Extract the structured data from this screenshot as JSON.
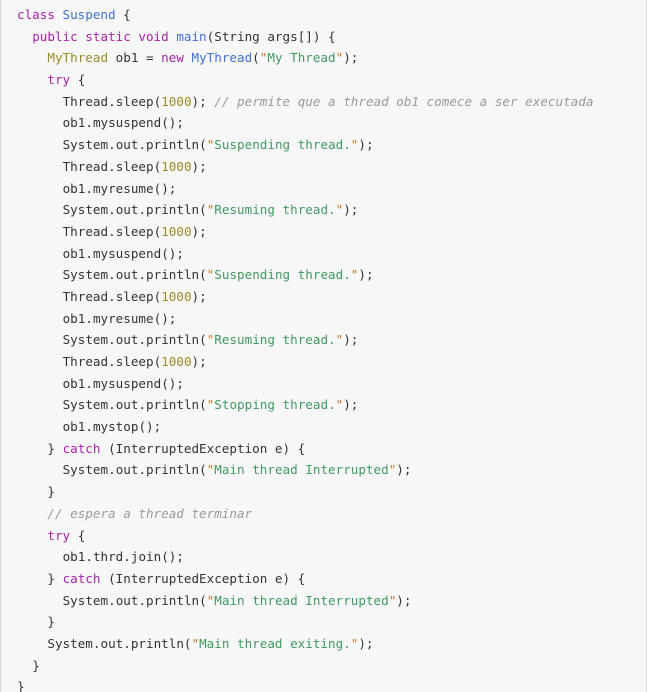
{
  "editor": {
    "language": "java",
    "background_color": "#f7f7f7",
    "border_color": "#d6d6d6",
    "theme": {
      "keyword_color": "#aa22aa",
      "type_color": "#4070d0",
      "declared_type_color": "#9e8a26",
      "number_color": "#9e8a26",
      "string_color": "#3f9a60",
      "quote_color": "#c07828",
      "comment_color": "#999999",
      "plain_color": "#333333"
    }
  },
  "code": {
    "lines": [
      {
        "indent": 0,
        "text": "class Suspend {"
      },
      {
        "indent": 1,
        "text": "public static void main(String args[]) {"
      },
      {
        "indent": 2,
        "text": "MyThread ob1 = new MyThread(\"My Thread\");"
      },
      {
        "indent": 2,
        "text": "try {"
      },
      {
        "indent": 3,
        "text": "Thread.sleep(1000); // permite que a thread ob1 comece a ser executada"
      },
      {
        "indent": 3,
        "text": "ob1.mysuspend();"
      },
      {
        "indent": 3,
        "text": "System.out.println(\"Suspending thread.\");"
      },
      {
        "indent": 3,
        "text": "Thread.sleep(1000);"
      },
      {
        "indent": 3,
        "text": "ob1.myresume();"
      },
      {
        "indent": 3,
        "text": "System.out.println(\"Resuming thread.\");"
      },
      {
        "indent": 3,
        "text": "Thread.sleep(1000);"
      },
      {
        "indent": 3,
        "text": "ob1.mysuspend();"
      },
      {
        "indent": 3,
        "text": "System.out.println(\"Suspending thread.\");"
      },
      {
        "indent": 3,
        "text": "Thread.sleep(1000);"
      },
      {
        "indent": 3,
        "text": "ob1.myresume();"
      },
      {
        "indent": 3,
        "text": "System.out.println(\"Resuming thread.\");"
      },
      {
        "indent": 3,
        "text": "Thread.sleep(1000);"
      },
      {
        "indent": 3,
        "text": "ob1.mysuspend();"
      },
      {
        "indent": 3,
        "text": "System.out.println(\"Stopping thread.\");"
      },
      {
        "indent": 3,
        "text": "ob1.mystop();"
      },
      {
        "indent": 2,
        "text": "} catch (InterruptedException e) {"
      },
      {
        "indent": 3,
        "text": "System.out.println(\"Main thread Interrupted\");"
      },
      {
        "indent": 2,
        "text": "}"
      },
      {
        "indent": 2,
        "text": "// espera a thread terminar"
      },
      {
        "indent": 2,
        "text": "try {"
      },
      {
        "indent": 3,
        "text": "ob1.thrd.join();"
      },
      {
        "indent": 2,
        "text": "} catch (InterruptedException e) {"
      },
      {
        "indent": 3,
        "text": "System.out.println(\"Main thread Interrupted\");"
      },
      {
        "indent": 2,
        "text": "}"
      },
      {
        "indent": 2,
        "text": "System.out.println(\"Main thread exiting.\");"
      },
      {
        "indent": 1,
        "text": "}"
      },
      {
        "indent": 0,
        "text": "}"
      }
    ]
  },
  "tokens": {
    "keywords": [
      "class",
      "public",
      "static",
      "void",
      "try",
      "catch",
      "new"
    ],
    "types": [
      "Suspend",
      "main"
    ],
    "declared_types": [
      "MyThread"
    ],
    "numbers": [
      "1000"
    ],
    "strings": [
      "My Thread",
      "Suspending thread.",
      "Resuming thread.",
      "Stopping thread.",
      "Main thread Interrupted",
      "Main thread exiting."
    ],
    "comments": [
      "// permite que a thread ob1 comece a ser executada",
      "// espera a thread terminar"
    ]
  }
}
